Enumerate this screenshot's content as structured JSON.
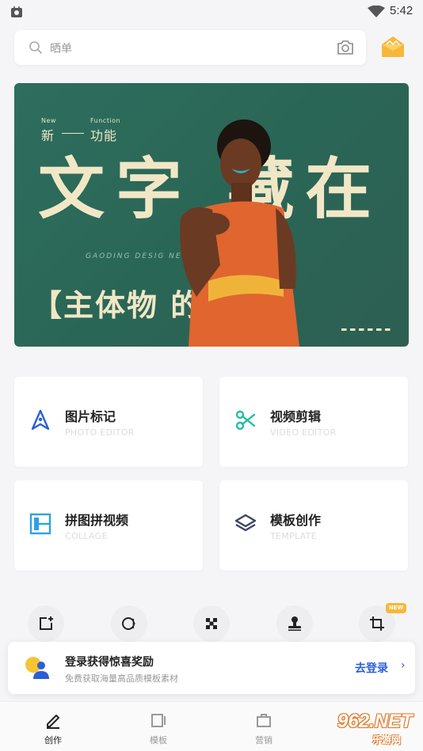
{
  "status_bar": {
    "time": "5:42"
  },
  "search": {
    "placeholder": "晒单"
  },
  "banner": {
    "label_new": "New",
    "label_function": "Function",
    "small_left": "新",
    "small_right": "功能",
    "big_text": "文字 藏在",
    "mid_en": "GAODING DESIG          NEW FUNCTION*",
    "sub_text": "【主体物    的背后】"
  },
  "cards": [
    {
      "title": "图片标记",
      "subtitle": "PHOTO EDITOR",
      "icon": "pen-nib-icon",
      "color": "#2a5fd6"
    },
    {
      "title": "视频剪辑",
      "subtitle": "VIDEO EDITOR",
      "icon": "scissors-icon",
      "color": "#1fbfa3"
    },
    {
      "title": "拼图拼视频",
      "subtitle": "COLLAGE",
      "icon": "collage-icon",
      "color": "#2ea2e6"
    },
    {
      "title": "模板创作",
      "subtitle": "TEMPLATE",
      "icon": "layers-icon",
      "color": "#3b4566"
    }
  ],
  "tools": [
    {
      "icon": "add-frame-icon",
      "label": ""
    },
    {
      "icon": "cutout-icon",
      "label": ""
    },
    {
      "icon": "mosaic-icon",
      "label": ""
    },
    {
      "icon": "stamp-icon",
      "label": ""
    },
    {
      "icon": "crop-icon",
      "label": "",
      "badge": "NEW"
    }
  ],
  "login_bar": {
    "title": "登录获得惊喜奖励",
    "subtitle": "免费获取海量高品质模板素材",
    "button": "去登录",
    "chevron": "›"
  },
  "tabs": [
    {
      "label": "创作",
      "icon": "pencil-icon",
      "active": true
    },
    {
      "label": "模板",
      "icon": "template-icon",
      "active": false
    },
    {
      "label": "营销",
      "icon": "briefcase-icon",
      "active": false
    }
  ],
  "watermark": {
    "text": "962.NET",
    "sub": "乐游网"
  },
  "colors": {
    "accent": "#2a5fd6",
    "banner_bg": "#2e6e5e",
    "badge": "#f7b83a"
  }
}
